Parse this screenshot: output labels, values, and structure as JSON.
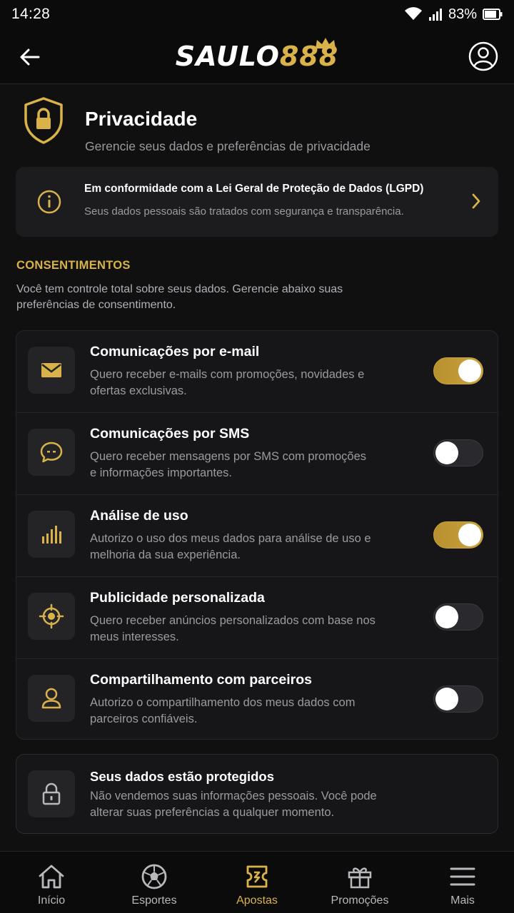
{
  "status_bar": {
    "time": "14:28",
    "battery": "83%"
  },
  "header": {
    "logo_part1": "SAULO",
    "logo_part2": "888"
  },
  "page": {
    "title": "Privacidade",
    "subtitle": "Gerencie seus dados e preferências de privacidade"
  },
  "lgpd_banner": {
    "title": "Em conformidade com a Lei Geral de Proteção de Dados (LGPD)",
    "description": "Seus dados pessoais são tratados com segurança e transparência."
  },
  "consents_section": {
    "heading": "CONSENTIMENTOS",
    "description": "Você tem controle total sobre seus dados. Gerencie abaixo suas preferências de consentimento.",
    "items": [
      {
        "icon": "mail-icon",
        "title": "Comunicações por e-mail",
        "description": "Quero receber e-mails com promoções, novidades e ofertas exclusivas.",
        "enabled": true
      },
      {
        "icon": "chat-icon",
        "title": "Comunicações por SMS",
        "description": "Quero receber mensagens por SMS com promoções e informações importantes.",
        "enabled": false
      },
      {
        "icon": "bar-chart-icon",
        "title": "Análise de uso",
        "description": "Autorizo o uso dos meus dados para análise de uso e melhoria da sua experiência.",
        "enabled": true
      },
      {
        "icon": "target-icon",
        "title": "Publicidade personalizada",
        "description": "Quero receber anúncios personalizados com base nos meus interesses.",
        "enabled": false
      },
      {
        "icon": "user-icon",
        "title": "Compartilhamento com parceiros",
        "description": "Autorizo o compartilhamento dos meus dados com parceiros confiáveis.",
        "enabled": false
      }
    ]
  },
  "protection_note": {
    "title": "Seus dados estão protegidos",
    "description": "Não vendemos suas informações pessoais. Você pode alterar suas preferências a qualquer momento."
  },
  "bottom_nav": [
    {
      "icon": "home-icon",
      "label": "Início",
      "active": false
    },
    {
      "icon": "soccer-ball-icon",
      "label": "Esportes",
      "active": false
    },
    {
      "icon": "ticket-icon",
      "label": "Apostas",
      "active": true
    },
    {
      "icon": "gift-icon",
      "label": "Promoções",
      "active": false
    },
    {
      "icon": "menu-icon",
      "label": "Mais",
      "active": false
    }
  ],
  "colors": {
    "accent": "#d9b24a",
    "background": "#101011",
    "card": "#161618"
  }
}
